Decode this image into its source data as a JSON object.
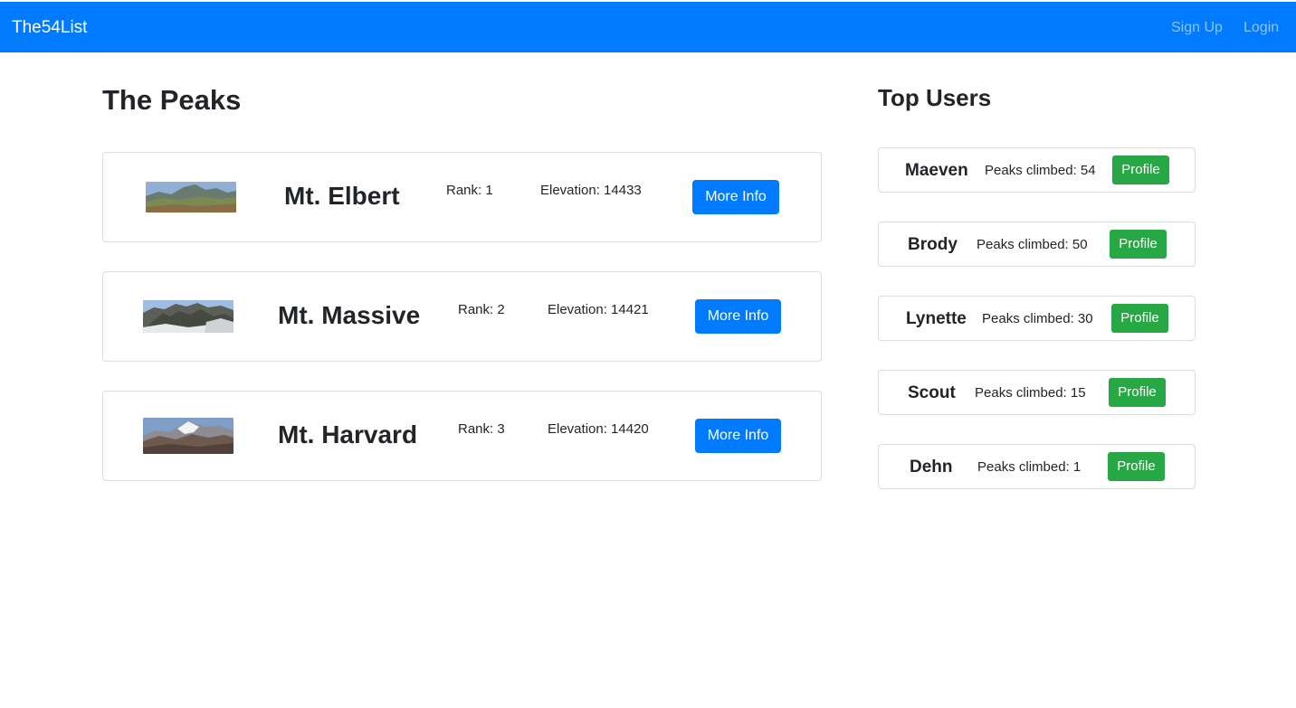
{
  "navbar": {
    "brand": "The54List",
    "links": [
      "Sign Up",
      "Login"
    ],
    "color": "#007bff"
  },
  "peaks_section": {
    "title": "The Peaks",
    "items": [
      {
        "name": "Mt. Elbert",
        "rank": "Rank: 1",
        "elevation": "Elevation: 14433",
        "button": "More Info"
      },
      {
        "name": "Mt. Massive",
        "rank": "Rank: 2",
        "elevation": "Elevation: 14421",
        "button": "More Info"
      },
      {
        "name": "Mt. Harvard",
        "rank": "Rank: 3",
        "elevation": "Elevation: 14420",
        "button": "More Info"
      }
    ]
  },
  "users_section": {
    "title": "Top Users",
    "items": [
      {
        "name": "Maeven",
        "peaks": "Peaks climbed: 54",
        "button": "Profile"
      },
      {
        "name": "Brody",
        "peaks": "Peaks climbed: 50",
        "button": "Profile"
      },
      {
        "name": "Lynette",
        "peaks": "Peaks climbed: 30",
        "button": "Profile"
      },
      {
        "name": "Scout",
        "peaks": "Peaks climbed: 15",
        "button": "Profile"
      },
      {
        "name": "Dehn",
        "peaks": "Peaks climbed: 1",
        "button": "Profile"
      }
    ]
  },
  "colors": {
    "primary": "#007bff",
    "success": "#28a745"
  }
}
